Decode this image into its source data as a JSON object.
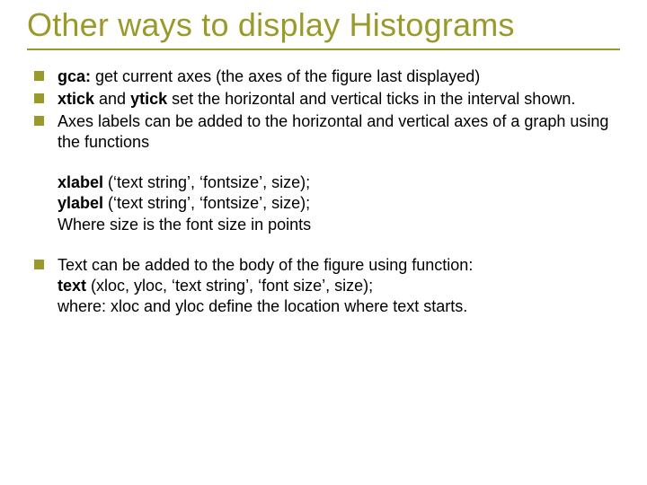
{
  "title": "Other ways to display Histograms",
  "bullets1": {
    "b1": {
      "bold": "gca:",
      "rest": " get current axes (the axes of the figure last displayed)"
    },
    "b2": {
      "bold1": "xtick",
      "mid": " and ",
      "bold2": "ytick",
      "rest": "  set the horizontal and vertical ticks in the interval shown."
    },
    "b3": {
      "text": "Axes labels can be added to the horizontal and vertical axes of a graph using the functions"
    }
  },
  "code1": {
    "l1": {
      "bold": "xlabel",
      "rest": " (‘text string’, ‘fontsize’, size);"
    },
    "l2": {
      "bold": "ylabel",
      "rest": " (‘text string’, ‘fontsize’, size);"
    },
    "l3": "Where size is the font size in points"
  },
  "bullets2": {
    "b4": {
      "line1": "Text can be added to the body of the figure using function:",
      "line2": {
        "bold": "text",
        "rest": " (xloc, yloc, ‘text string’, ‘font size’, size);"
      },
      "line3": "where: xloc and yloc define the location where text starts."
    }
  }
}
